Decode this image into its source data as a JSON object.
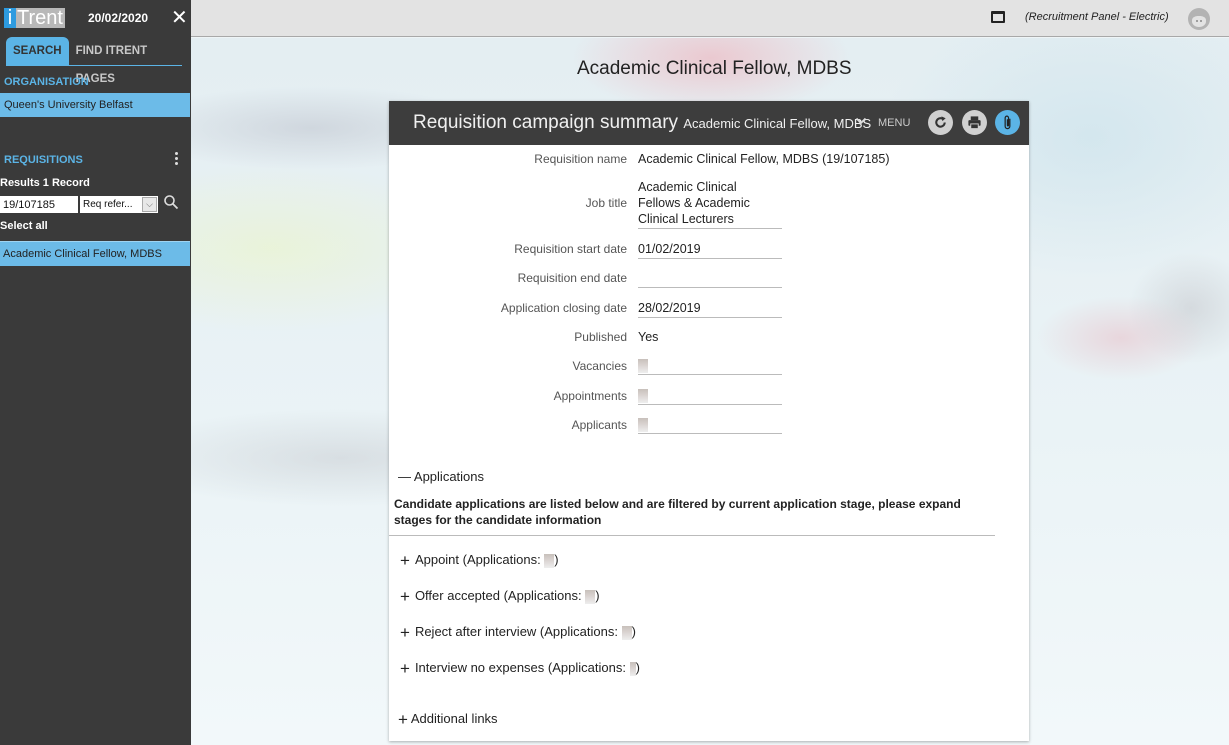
{
  "app": {
    "logo_i": "i",
    "logo_rest": "Trent",
    "date": "20/02/2020",
    "close_glyph": "✕"
  },
  "sidebar": {
    "tabs": [
      {
        "label": "SEARCH",
        "active": true
      },
      {
        "label": "FIND ITRENT PAGES",
        "active": false
      }
    ],
    "organisation_label": "ORGANISATION",
    "organisation_value": "Queen's University Belfast",
    "requisitions_label": "REQUISITIONS",
    "results_text": "Results 1 Record",
    "search_value": "19/107185",
    "search_type_selected": "Req refer...",
    "select_all": "Select all",
    "results": [
      {
        "label": "Academic Clinical Fellow, MDBS",
        "selected": true
      }
    ]
  },
  "topbar": {
    "role_text": "(Recruitment Panel - Electric)"
  },
  "page": {
    "title": "Academic Clinical Fellow, MDBS"
  },
  "panel": {
    "title": "Requisition campaign summary",
    "subtitle": "Academic Clinical Fellow, MDBS",
    "menu_label": "MENU",
    "fields": [
      {
        "label": "Requisition name",
        "value": "Academic Clinical Fellow, MDBS (19/107185)"
      },
      {
        "label": "Job title",
        "value": "Academic Clinical Fellows & Academic Clinical Lecturers"
      },
      {
        "label": "Requisition start date",
        "value": "01/02/2019"
      },
      {
        "label": "Requisition end date",
        "value": ""
      },
      {
        "label": "Application closing date",
        "value": "28/02/2019"
      },
      {
        "label": "Published",
        "value": "Yes"
      },
      {
        "label": "Vacancies",
        "value": "[redacted]"
      },
      {
        "label": "Appointments",
        "value": "[redacted]"
      },
      {
        "label": "Applicants",
        "value": "[redacted]"
      }
    ],
    "applications": {
      "toggle_glyph": "—",
      "label": "Applications",
      "description": "Candidate applications are listed below and are filtered by current application stage, please expand stages for the candidate information",
      "stages": [
        {
          "name": "Appoint",
          "prefix": "Appoint (Applications: ",
          "count": "[redacted]"
        },
        {
          "name": "Offer accepted",
          "prefix": "Offer accepted (Applications: ",
          "count": "[redacted]"
        },
        {
          "name": "Reject after interview",
          "prefix": "Reject after interview (Applications: ",
          "count": "[redacted]"
        },
        {
          "name": "Interview no expenses",
          "prefix": "Interview no expenses (Applications: ",
          "count": "[redacted]"
        }
      ],
      "expand_glyph": "+",
      "suffix": ")"
    },
    "additional_links": "Additional links"
  },
  "colors": {
    "accent": "#5bb4e6",
    "sidebar_bg": "#3a3a3a",
    "panel_header_bg": "#3d3d3d"
  }
}
